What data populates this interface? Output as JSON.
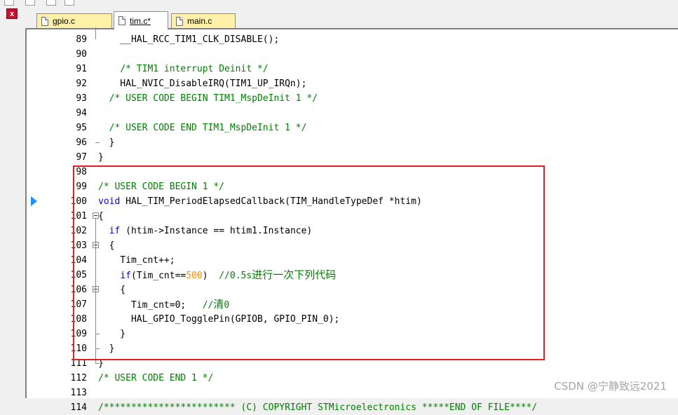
{
  "tabs": [
    {
      "label": "gpio.c",
      "active": false
    },
    {
      "label": "tim.c*",
      "active": true
    },
    {
      "label": "main.c",
      "active": false
    }
  ],
  "close_label": "x",
  "lines": [
    {
      "num": "89",
      "code": "    __HAL_RCC_TIM1_CLK_DISABLE();"
    },
    {
      "num": "90",
      "code": ""
    },
    {
      "num": "91",
      "code": "    /* TIM1 interrupt Deinit */"
    },
    {
      "num": "92",
      "code": "    HAL_NVIC_DisableIRQ(TIM1_UP_IRQn);"
    },
    {
      "num": "93",
      "code": "  /* USER CODE BEGIN TIM1_MspDeInit 1 */"
    },
    {
      "num": "94",
      "code": ""
    },
    {
      "num": "95",
      "code": "  /* USER CODE END TIM1_MspDeInit 1 */"
    },
    {
      "num": "96",
      "code": "  }"
    },
    {
      "num": "97",
      "code": "}"
    },
    {
      "num": "98",
      "code": ""
    },
    {
      "num": "99",
      "code": "/* USER CODE BEGIN 1 */"
    },
    {
      "num": "100",
      "code": "void HAL_TIM_PeriodElapsedCallback(TIM_HandleTypeDef *htim)"
    },
    {
      "num": "101",
      "code": "{"
    },
    {
      "num": "102",
      "code": "  if (htim->Instance == htim1.Instance)"
    },
    {
      "num": "103",
      "code": "  {"
    },
    {
      "num": "104",
      "code": "    Tim_cnt++;"
    },
    {
      "num": "105",
      "code": "    if(Tim_cnt==500)  //0.5s进行一次下列代码"
    },
    {
      "num": "106",
      "code": "    {"
    },
    {
      "num": "107",
      "code": "      Tim_cnt=0;   //清0"
    },
    {
      "num": "108",
      "code": "      HAL_GPIO_TogglePin(GPIOB, GPIO_PIN_0);"
    },
    {
      "num": "109",
      "code": "    }"
    },
    {
      "num": "110",
      "code": "  }"
    },
    {
      "num": "111",
      "code": "}"
    },
    {
      "num": "112",
      "code": "/* USER CODE END 1 */"
    },
    {
      "num": "113",
      "code": ""
    },
    {
      "num": "114",
      "code": "/************************ (C) COPYRIGHT STMicroelectronics *****END OF FILE****/"
    }
  ],
  "watermark": "CSDN @宁静致远2021",
  "colors": {
    "keyword": "#0000ff",
    "comment": "#008000",
    "number": "#ff8c00",
    "highlight_box": "#e02020",
    "tab_inactive": "#fff1a8"
  }
}
